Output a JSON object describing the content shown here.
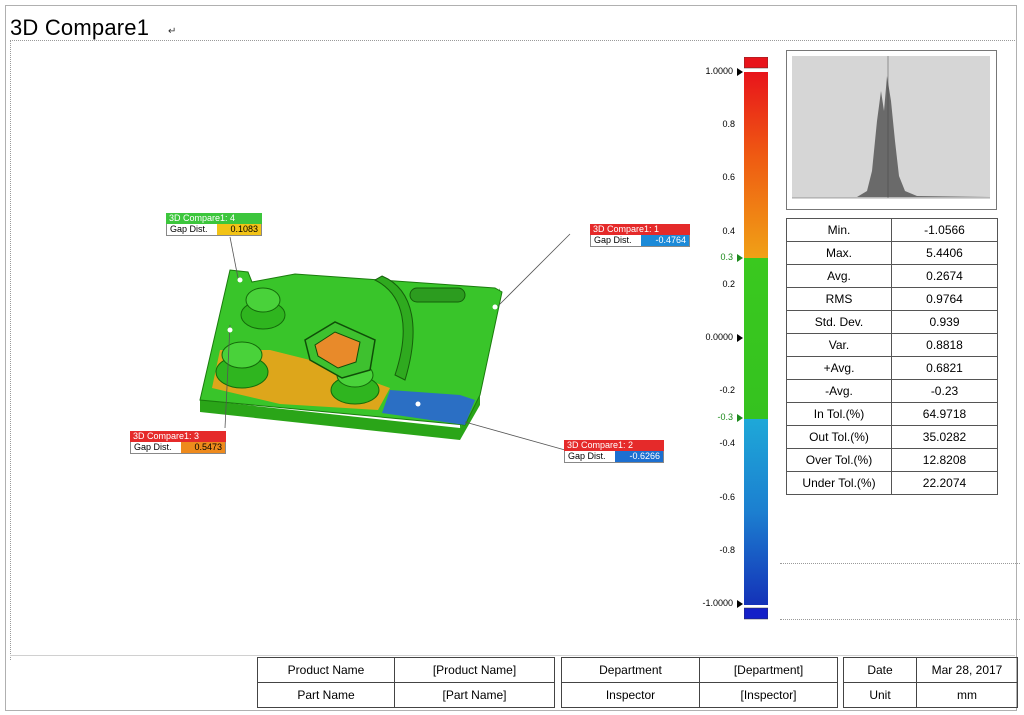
{
  "page": {
    "title": "3D Compare1",
    "title_mark": "↵"
  },
  "colors": {
    "red": "#e8141b",
    "orange": "#ef8f12",
    "green": "#35c21f",
    "blue": "#1c7fd0",
    "label_red": "#e52a2a",
    "label_green": "#3cc63c"
  },
  "scale": {
    "labels": [
      "1.0000",
      "0.8",
      "0.6",
      "0.4",
      "0.3",
      "0.2",
      "0.0000",
      "-0.2",
      "-0.3",
      "-0.4",
      "-0.6",
      "-0.8",
      "-1.0000"
    ],
    "max": 1.0,
    "min": -1.0,
    "upper_tol": 0.3,
    "lower_tol": -0.3
  },
  "stats": [
    {
      "label": "Min.",
      "value": "-1.0566"
    },
    {
      "label": "Max.",
      "value": "5.4406"
    },
    {
      "label": "Avg.",
      "value": "0.2674"
    },
    {
      "label": "RMS",
      "value": "0.9764"
    },
    {
      "label": "Std. Dev.",
      "value": "0.939"
    },
    {
      "label": "Var.",
      "value": "0.8818"
    },
    {
      "label": "+Avg.",
      "value": "0.6821"
    },
    {
      "label": "-Avg.",
      "value": "-0.23"
    },
    {
      "label": "In Tol.(%)",
      "value": "64.9718"
    },
    {
      "label": "Out Tol.(%)",
      "value": "35.0282"
    },
    {
      "label": "Over Tol.(%)",
      "value": "12.8208"
    },
    {
      "label": "Under Tol.(%)",
      "value": "22.2074"
    }
  ],
  "annotations": {
    "a1": {
      "title": "3D Compare1: 1",
      "label": "Gap Dist.",
      "value": "-0.4764"
    },
    "a2": {
      "title": "3D Compare1: 2",
      "label": "Gap Dist.",
      "value": "-0.6266"
    },
    "a3": {
      "title": "3D Compare1: 3",
      "label": "Gap Dist.",
      "value": "0.5473"
    },
    "a4": {
      "title": "3D Compare1: 4",
      "label": "Gap Dist.",
      "value": "0.1083"
    }
  },
  "footer": {
    "product_name_label": "Product Name",
    "product_name_value": "[Product Name]",
    "part_name_label": "Part Name",
    "part_name_value": "[Part Name]",
    "department_label": "Department",
    "department_value": "[Department]",
    "inspector_label": "Inspector",
    "inspector_value": "[Inspector]",
    "date_label": "Date",
    "date_value": "Mar 28, 2017",
    "unit_label": "Unit",
    "unit_value": "mm"
  }
}
